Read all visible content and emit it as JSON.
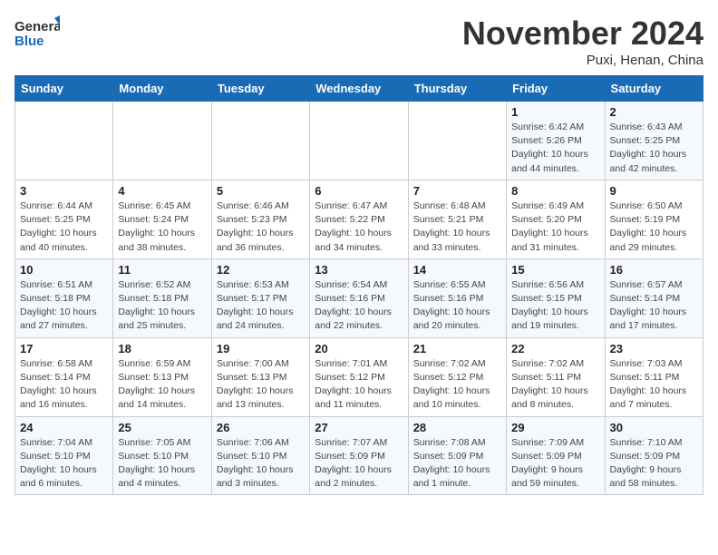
{
  "logo": {
    "line1": "General",
    "line2": "Blue"
  },
  "title": "November 2024",
  "location": "Puxi, Henan, China",
  "weekdays": [
    "Sunday",
    "Monday",
    "Tuesday",
    "Wednesday",
    "Thursday",
    "Friday",
    "Saturday"
  ],
  "weeks": [
    [
      {
        "day": "",
        "info": ""
      },
      {
        "day": "",
        "info": ""
      },
      {
        "day": "",
        "info": ""
      },
      {
        "day": "",
        "info": ""
      },
      {
        "day": "",
        "info": ""
      },
      {
        "day": "1",
        "info": "Sunrise: 6:42 AM\nSunset: 5:26 PM\nDaylight: 10 hours and 44 minutes."
      },
      {
        "day": "2",
        "info": "Sunrise: 6:43 AM\nSunset: 5:25 PM\nDaylight: 10 hours and 42 minutes."
      }
    ],
    [
      {
        "day": "3",
        "info": "Sunrise: 6:44 AM\nSunset: 5:25 PM\nDaylight: 10 hours and 40 minutes."
      },
      {
        "day": "4",
        "info": "Sunrise: 6:45 AM\nSunset: 5:24 PM\nDaylight: 10 hours and 38 minutes."
      },
      {
        "day": "5",
        "info": "Sunrise: 6:46 AM\nSunset: 5:23 PM\nDaylight: 10 hours and 36 minutes."
      },
      {
        "day": "6",
        "info": "Sunrise: 6:47 AM\nSunset: 5:22 PM\nDaylight: 10 hours and 34 minutes."
      },
      {
        "day": "7",
        "info": "Sunrise: 6:48 AM\nSunset: 5:21 PM\nDaylight: 10 hours and 33 minutes."
      },
      {
        "day": "8",
        "info": "Sunrise: 6:49 AM\nSunset: 5:20 PM\nDaylight: 10 hours and 31 minutes."
      },
      {
        "day": "9",
        "info": "Sunrise: 6:50 AM\nSunset: 5:19 PM\nDaylight: 10 hours and 29 minutes."
      }
    ],
    [
      {
        "day": "10",
        "info": "Sunrise: 6:51 AM\nSunset: 5:18 PM\nDaylight: 10 hours and 27 minutes."
      },
      {
        "day": "11",
        "info": "Sunrise: 6:52 AM\nSunset: 5:18 PM\nDaylight: 10 hours and 25 minutes."
      },
      {
        "day": "12",
        "info": "Sunrise: 6:53 AM\nSunset: 5:17 PM\nDaylight: 10 hours and 24 minutes."
      },
      {
        "day": "13",
        "info": "Sunrise: 6:54 AM\nSunset: 5:16 PM\nDaylight: 10 hours and 22 minutes."
      },
      {
        "day": "14",
        "info": "Sunrise: 6:55 AM\nSunset: 5:16 PM\nDaylight: 10 hours and 20 minutes."
      },
      {
        "day": "15",
        "info": "Sunrise: 6:56 AM\nSunset: 5:15 PM\nDaylight: 10 hours and 19 minutes."
      },
      {
        "day": "16",
        "info": "Sunrise: 6:57 AM\nSunset: 5:14 PM\nDaylight: 10 hours and 17 minutes."
      }
    ],
    [
      {
        "day": "17",
        "info": "Sunrise: 6:58 AM\nSunset: 5:14 PM\nDaylight: 10 hours and 16 minutes."
      },
      {
        "day": "18",
        "info": "Sunrise: 6:59 AM\nSunset: 5:13 PM\nDaylight: 10 hours and 14 minutes."
      },
      {
        "day": "19",
        "info": "Sunrise: 7:00 AM\nSunset: 5:13 PM\nDaylight: 10 hours and 13 minutes."
      },
      {
        "day": "20",
        "info": "Sunrise: 7:01 AM\nSunset: 5:12 PM\nDaylight: 10 hours and 11 minutes."
      },
      {
        "day": "21",
        "info": "Sunrise: 7:02 AM\nSunset: 5:12 PM\nDaylight: 10 hours and 10 minutes."
      },
      {
        "day": "22",
        "info": "Sunrise: 7:02 AM\nSunset: 5:11 PM\nDaylight: 10 hours and 8 minutes."
      },
      {
        "day": "23",
        "info": "Sunrise: 7:03 AM\nSunset: 5:11 PM\nDaylight: 10 hours and 7 minutes."
      }
    ],
    [
      {
        "day": "24",
        "info": "Sunrise: 7:04 AM\nSunset: 5:10 PM\nDaylight: 10 hours and 6 minutes."
      },
      {
        "day": "25",
        "info": "Sunrise: 7:05 AM\nSunset: 5:10 PM\nDaylight: 10 hours and 4 minutes."
      },
      {
        "day": "26",
        "info": "Sunrise: 7:06 AM\nSunset: 5:10 PM\nDaylight: 10 hours and 3 minutes."
      },
      {
        "day": "27",
        "info": "Sunrise: 7:07 AM\nSunset: 5:09 PM\nDaylight: 10 hours and 2 minutes."
      },
      {
        "day": "28",
        "info": "Sunrise: 7:08 AM\nSunset: 5:09 PM\nDaylight: 10 hours and 1 minute."
      },
      {
        "day": "29",
        "info": "Sunrise: 7:09 AM\nSunset: 5:09 PM\nDaylight: 9 hours and 59 minutes."
      },
      {
        "day": "30",
        "info": "Sunrise: 7:10 AM\nSunset: 5:09 PM\nDaylight: 9 hours and 58 minutes."
      }
    ]
  ]
}
